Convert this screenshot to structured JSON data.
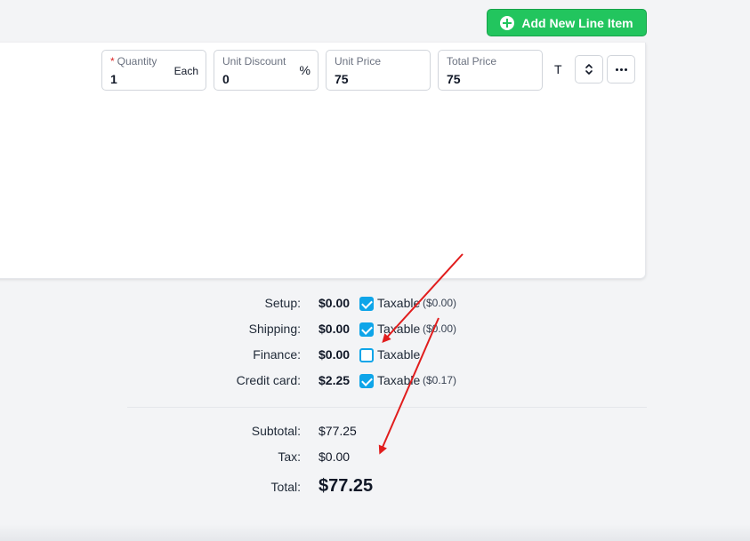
{
  "header": {
    "add_button_label": "Add New Line Item"
  },
  "line_item": {
    "quantity": {
      "label": "Quantity",
      "value": "1",
      "unit": "Each"
    },
    "unit_discount": {
      "label": "Unit Discount",
      "value": "0",
      "unit": "%"
    },
    "unit_price": {
      "label": "Unit Price",
      "value": "75"
    },
    "total_price": {
      "label": "Total Price",
      "value": "75"
    },
    "tax_marker": "T"
  },
  "fees": [
    {
      "label": "Setup:",
      "amount": "$0.00",
      "taxable": true,
      "taxable_label": "Taxable",
      "tax_amount": "($0.00)"
    },
    {
      "label": "Shipping:",
      "amount": "$0.00",
      "taxable": true,
      "taxable_label": "Taxable",
      "tax_amount": "($0.00)"
    },
    {
      "label": "Finance:",
      "amount": "$0.00",
      "taxable": false,
      "taxable_label": "Taxable",
      "tax_amount": ""
    },
    {
      "label": "Credit card:",
      "amount": "$2.25",
      "taxable": true,
      "taxable_label": "Taxable",
      "tax_amount": "($0.17)"
    }
  ],
  "summary": {
    "subtotal_label": "Subtotal:",
    "subtotal_value": "$77.25",
    "tax_label": "Tax:",
    "tax_value": "$0.00",
    "total_label": "Total:",
    "total_value": "$77.25"
  },
  "colors": {
    "accent_green": "#22c55e",
    "checkbox_blue": "#0ea5e9",
    "annotation_red": "#e11d1d"
  },
  "icons": [
    "plus-circle-icon",
    "sort-arrows-icon",
    "more-dots-icon",
    "checkbox-icon"
  ]
}
